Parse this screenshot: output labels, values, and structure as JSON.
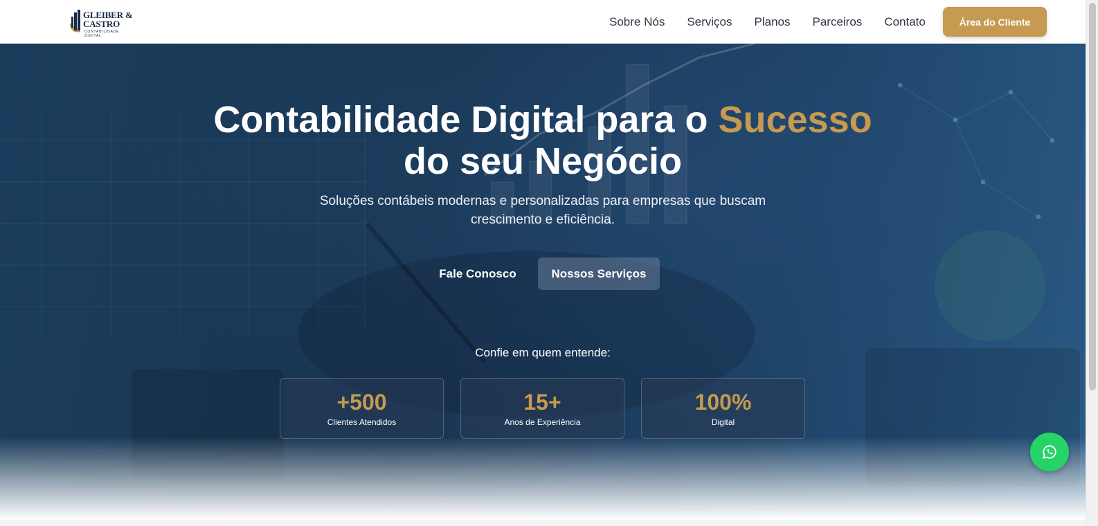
{
  "brand": {
    "name_line1": "GLEIBER &",
    "name_line2": "CASTRO",
    "tagline": "CONTABILIDADE DIGITAL"
  },
  "nav": {
    "items": [
      "Sobre Nós",
      "Serviços",
      "Planos",
      "Parceiros",
      "Contato"
    ],
    "client_button": "Área do Cliente"
  },
  "hero": {
    "title_part1": "Contabilidade Digital para o ",
    "title_accent": "Sucesso",
    "title_part2": "do seu Negócio",
    "subtitle": "Soluções contábeis modernas e personalizadas para empresas que buscam crescimento e eficiência.",
    "primary_button": "Fale Conosco",
    "secondary_button": "Nossos Serviços",
    "trust_label": "Confie em quem entende:"
  },
  "stats": [
    {
      "value": "+500",
      "label": "Clientes Atendidos"
    },
    {
      "value": "15+",
      "label": "Anos de Experiência"
    },
    {
      "value": "100%",
      "label": "Digital"
    }
  ],
  "colors": {
    "accent": "#c69a50",
    "hero_bg": "#1b3d5c",
    "whatsapp": "#25d366"
  },
  "icons": {
    "logo": "building-logo-icon",
    "floating": "whatsapp-icon"
  }
}
